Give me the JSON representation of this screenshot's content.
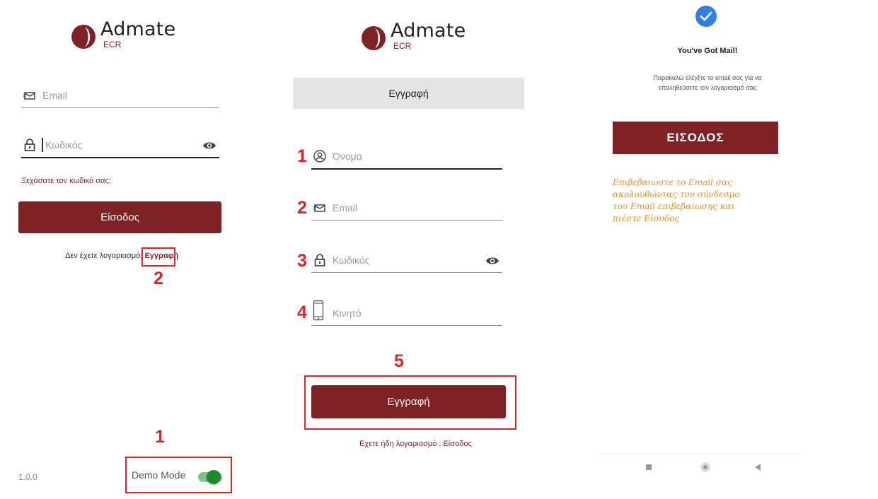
{
  "login": {
    "logo_name": "Admate",
    "logo_sub": "ECR",
    "email_label": "Email",
    "password_label": "Κωδικός",
    "forgot_link": "Ξεχάσατε τον κωδικό σας;",
    "login_button": "Είσοδος",
    "no_account_text": "Δεν έχετε λογαριασμό;",
    "register_link": "Εγγραφή",
    "version": "1.0.0",
    "demo_mode_label": "Demo Mode",
    "demo_mode_on": true
  },
  "register": {
    "logo_name": "Admate",
    "logo_sub": "ECR",
    "header_title": "Εγγραφή",
    "name_label": "Όνομα",
    "email_label": "Email",
    "password_label": "Κωδικός",
    "mobile_label": "Κινητό",
    "register_button": "Εγγραφή",
    "have_account_text": "Εχετε ήδη λογαριασμό ; Είσοδος"
  },
  "mail": {
    "title": "You've Got Mail!",
    "message_line1": "Παρακαλώ ελέγξτε το email σας για να",
    "message_line2": "επαληθεύσετε τον λογαριασμό σας",
    "login_button": "ΕΙΣΟΔΟΣ",
    "note_line1": "Επιβεβαιώστε το Email σας",
    "note_line2": "ακολουθώντας τον σύνδεσμο",
    "note_line3": "του Email επιβεβαίωσης και",
    "note_line4": "πιέστε Είσοδος"
  },
  "annotations": {
    "login_step1": "1",
    "login_step2": "2",
    "reg_step1": "1",
    "reg_step2": "2",
    "reg_step3": "3",
    "reg_step4": "4",
    "reg_step5": "5"
  },
  "colors": {
    "brand": "#7f2226",
    "annotation": "#e02424",
    "toggle_on": "#1e8a2e",
    "note": "#e8901c",
    "check": "#2f7fe6"
  },
  "icons": [
    "logo-mark-icon",
    "envelope-icon",
    "lock-icon",
    "eye-icon",
    "user-icon",
    "mobile-icon",
    "check-circle-icon",
    "nav-square-icon",
    "nav-circle-icon",
    "nav-back-icon"
  ]
}
